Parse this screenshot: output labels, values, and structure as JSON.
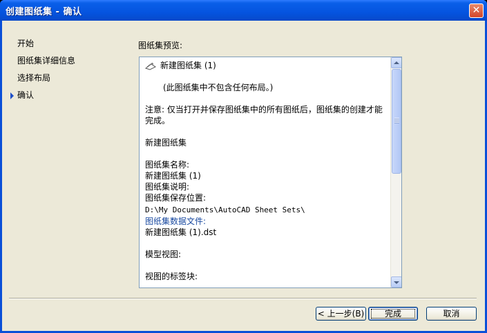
{
  "window": {
    "title": "创建图纸集 - 确认",
    "close_label": "✕"
  },
  "nav": {
    "items": [
      {
        "label": "开始"
      },
      {
        "label": "图纸集详细信息"
      },
      {
        "label": "选择布局"
      },
      {
        "label": "确认",
        "current": true
      }
    ]
  },
  "preview": {
    "label": "图纸集预览:",
    "root_name": "新建图纸集 (1)",
    "no_layouts": "(此图纸集中不包含任何布局。)",
    "note_line1": "注意: 仅当打开并保存图纸集中的所有图纸后，图纸集的创建才能",
    "note_line2": "完成。",
    "heading": "新建图纸集",
    "name_label": "图纸集名称:",
    "name_value": "新建图纸集 (1)",
    "desc_label": "图纸集说明:",
    "save_label": "图纸集保存位置:",
    "save_path": "D:\\My Documents\\AutoCAD Sheet Sets\\",
    "data_file_label": "图纸集数据文件:",
    "data_file_value": "新建图纸集 (1).dst",
    "model_view_label": "模型视图:",
    "view_label_block": "视图的标签块:"
  },
  "buttons": {
    "back": "< 上一步(B)",
    "finish": "完成",
    "cancel": "取消"
  },
  "colors": {
    "title_bar": "#0554e0",
    "dialog_bg": "#ece9d8",
    "link_blue": "#1a4aa0",
    "nav_arrow": "#2050c8"
  }
}
